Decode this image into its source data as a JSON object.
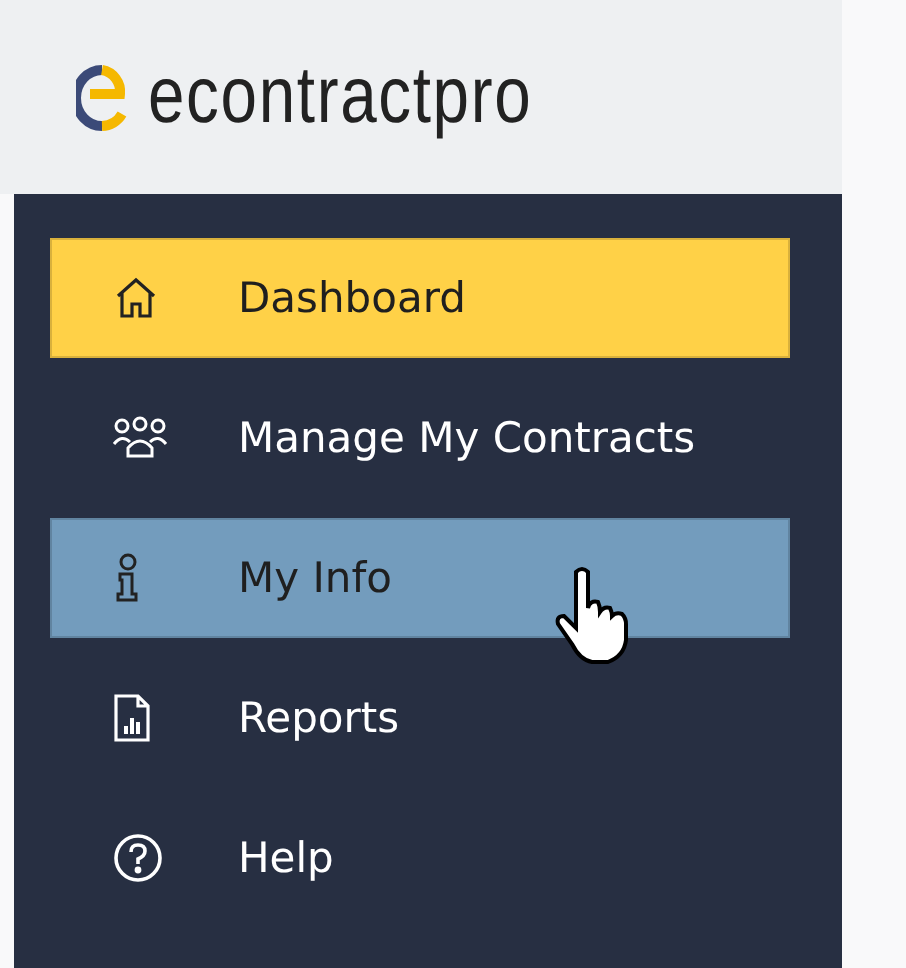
{
  "header": {
    "logo_text": "econtractpro"
  },
  "sidebar": {
    "items": [
      {
        "label": "Dashboard",
        "selected": true,
        "hovered": false
      },
      {
        "label": "Manage My Contracts",
        "selected": false,
        "hovered": false
      },
      {
        "label": "My Info",
        "selected": false,
        "hovered": true
      },
      {
        "label": "Reports",
        "selected": false,
        "hovered": false
      },
      {
        "label": "Help",
        "selected": false,
        "hovered": false
      }
    ]
  }
}
